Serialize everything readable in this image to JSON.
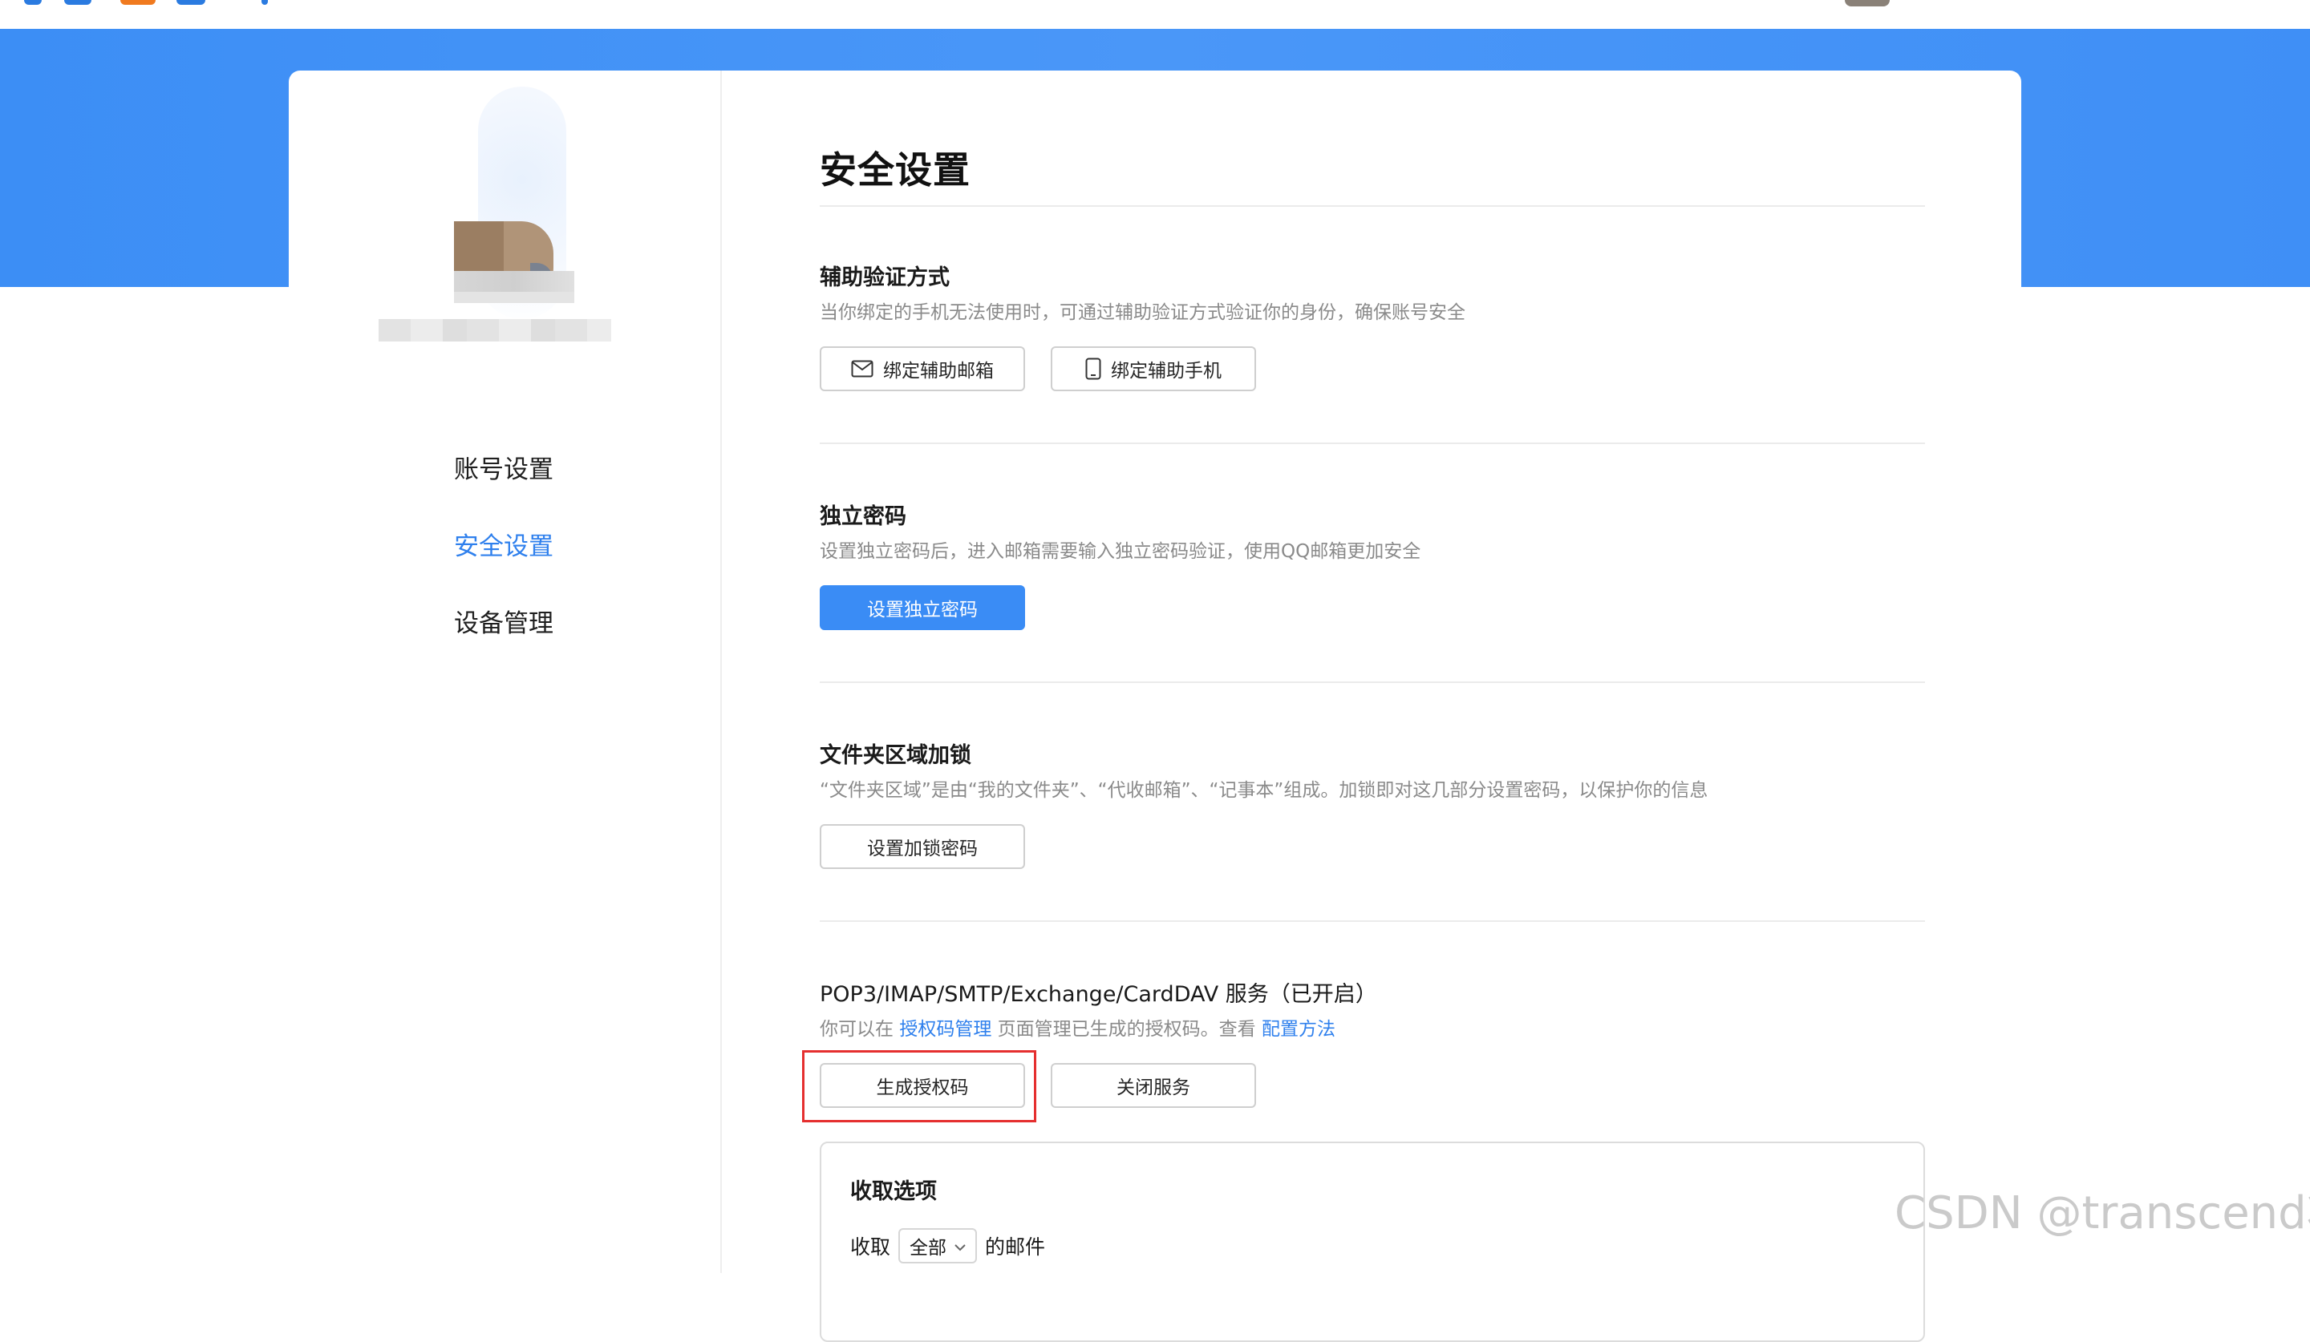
{
  "page": {
    "title": "安全设置"
  },
  "sidebar": {
    "items": [
      {
        "label": "账号设置"
      },
      {
        "label": "安全设置"
      },
      {
        "label": "设备管理"
      }
    ],
    "active_index": 1
  },
  "sections": {
    "aux_verify": {
      "title": "辅助验证方式",
      "desc": "当你绑定的手机无法使用时，可通过辅助验证方式验证你的身份，确保账号安全",
      "buttons": {
        "email": "绑定辅助邮箱",
        "phone": "绑定辅助手机"
      }
    },
    "independent_password": {
      "title": "独立密码",
      "desc": "设置独立密码后，进入邮箱需要输入独立密码验证，使用QQ邮箱更加安全",
      "button": "设置独立密码"
    },
    "folder_lock": {
      "title": "文件夹区域加锁",
      "desc": "“文件夹区域”是由“我的文件夹”、“代收邮箱”、“记事本”组成。加锁即对这几部分设置密码，以保护你的信息",
      "button": "设置加锁密码"
    },
    "protocol_service": {
      "title": "POP3/IMAP/SMTP/Exchange/CardDAV 服务（已开启）",
      "desc_prefix": "你可以在",
      "desc_link1": "授权码管理",
      "desc_middle": "页面管理已生成的授权码。查看",
      "desc_link2": "配置方法",
      "buttons": {
        "generate": "生成授权码",
        "close": "关闭服务"
      }
    },
    "receive_options": {
      "title": "收取选项",
      "row_prefix": "收取",
      "select_value": "全部",
      "row_suffix": "的邮件"
    }
  },
  "watermark": "CSDN @transcend壮",
  "colors": {
    "accent": "#2f80ed",
    "primary_button": "#3a8cf5",
    "hero": "#4a97f8",
    "highlight_border": "#e52f2f"
  },
  "icons": {
    "email": "mail-icon",
    "phone": "phone-icon",
    "select": "chevron-down-icon"
  }
}
